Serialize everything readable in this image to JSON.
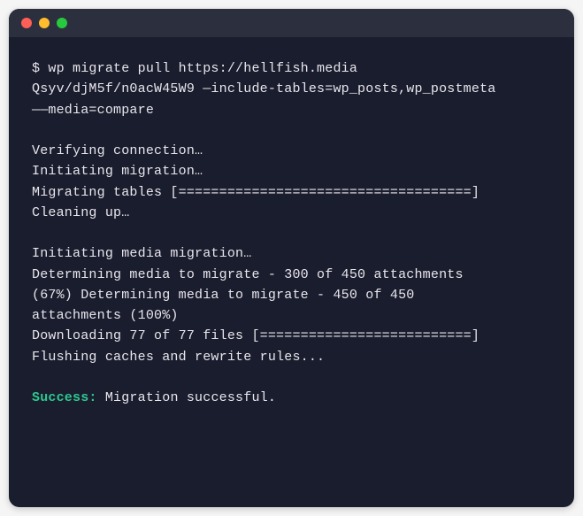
{
  "command": {
    "prompt": "$ ",
    "line1": "wp migrate pull https://hellfish.media",
    "line2": "Qsyv/djM5f/n0acW45W9 —include-tables=wp_posts,wp_postmeta",
    "line3": "——media=compare"
  },
  "output": {
    "verifying": "Verifying connection…",
    "initiating": "Initiating migration…",
    "migrating_tables": "Migrating tables [====================================]",
    "cleaning": "Cleaning up…",
    "media_init": "Initiating media migration…",
    "media_progress1": "Determining media to migrate - 300 of 450 attachments",
    "media_progress2": "(67%) Determining media to migrate - 450 of 450",
    "media_progress3": "attachments (100%)",
    "downloading": "Downloading 77 of 77 files [==========================]",
    "flushing": "Flushing caches and rewrite rules..."
  },
  "result": {
    "success_label": "Success:",
    "success_message": " Migration successful."
  }
}
